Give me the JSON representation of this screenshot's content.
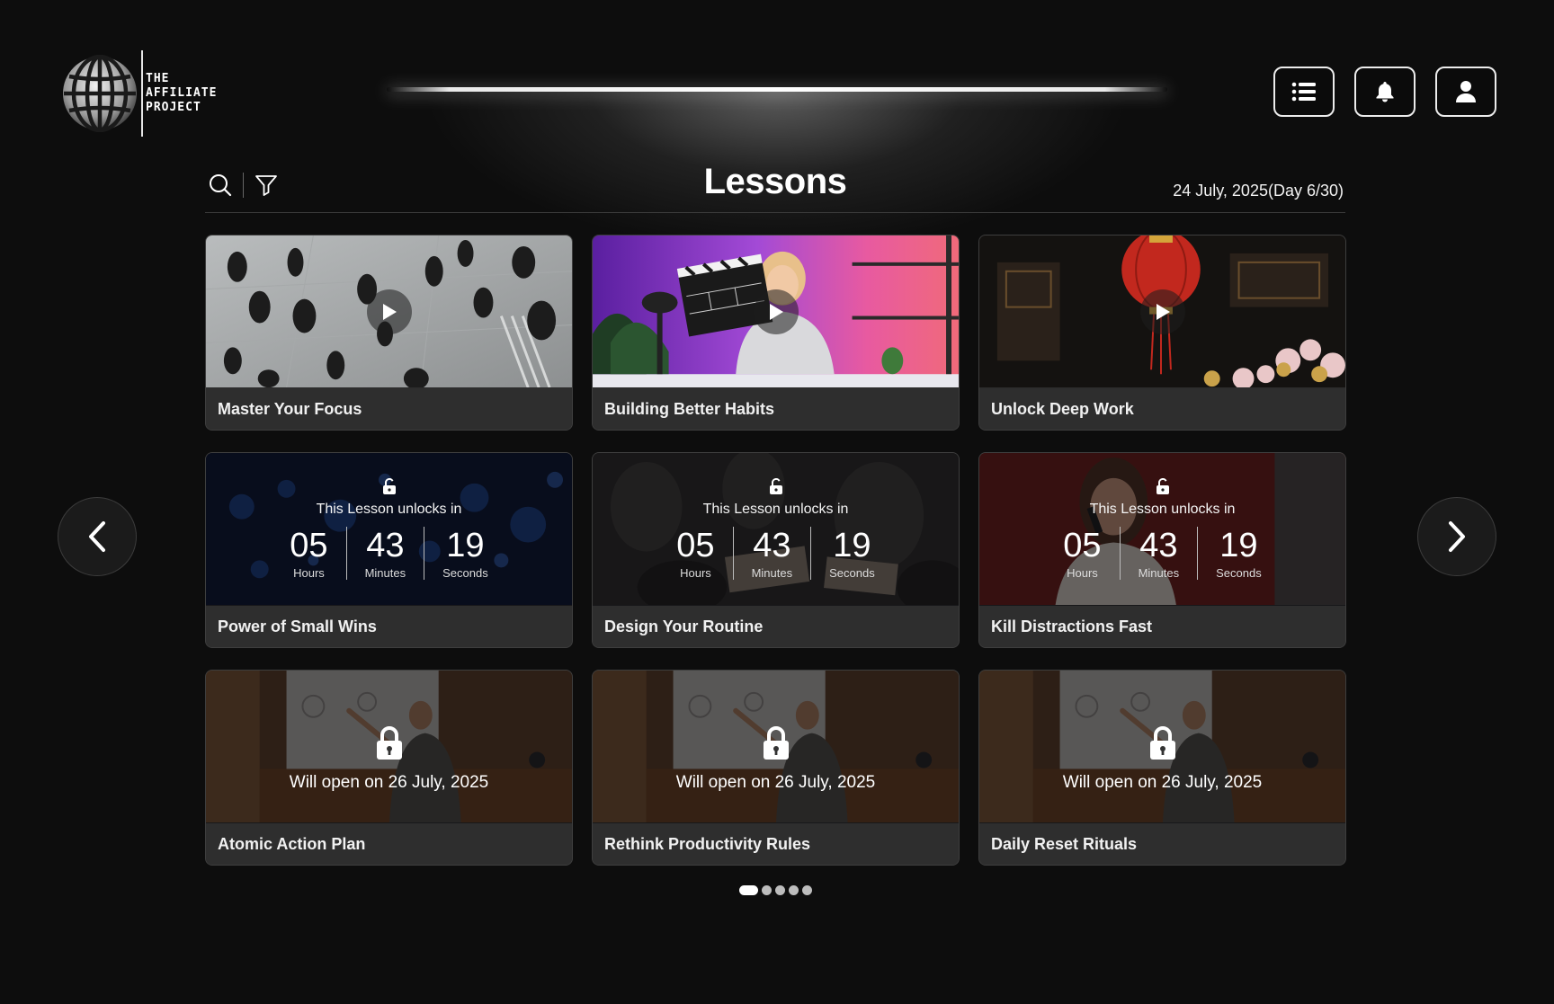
{
  "brand": {
    "name_lines": [
      "THE",
      "AFFILIATE",
      "PROJECT"
    ]
  },
  "header": {
    "buttons": [
      {
        "icon": "list-icon"
      },
      {
        "icon": "bell-icon"
      },
      {
        "icon": "user-icon"
      }
    ]
  },
  "toolbar": {
    "title": "Lessons",
    "date": "24 July, 2025(Day 6/30)",
    "icons": [
      "search-icon",
      "filter-icon"
    ]
  },
  "lessons": [
    {
      "title": "Master Your Focus",
      "status": "available"
    },
    {
      "title": "Building Better Habits",
      "status": "available"
    },
    {
      "title": "Unlock Deep Work",
      "status": "available"
    },
    {
      "title": "Power of Small Wins",
      "status": "countdown",
      "unlock_text": "This Lesson unlocks in",
      "hours": "05",
      "minutes": "43",
      "seconds": "19",
      "hours_label": "Hours",
      "minutes_label": "Minutes",
      "seconds_label": "Seconds"
    },
    {
      "title": "Design Your Routine",
      "status": "countdown",
      "unlock_text": "This Lesson unlocks in",
      "hours": "05",
      "minutes": "43",
      "seconds": "19",
      "hours_label": "Hours",
      "minutes_label": "Minutes",
      "seconds_label": "Seconds"
    },
    {
      "title": "Kill Distractions Fast",
      "status": "countdown",
      "unlock_text": "This Lesson unlocks in",
      "hours": "05",
      "minutes": "43",
      "seconds": "19",
      "hours_label": "Hours",
      "minutes_label": "Minutes",
      "seconds_label": "Seconds"
    },
    {
      "title": "Atomic Action Plan",
      "status": "locked",
      "open_text": "Will open on 26 July, 2025"
    },
    {
      "title": "Rethink Productivity Rules",
      "status": "locked",
      "open_text": "Will open on 26 July, 2025"
    },
    {
      "title": "Daily Reset Rituals",
      "status": "locked",
      "open_text": "Will open on 26 July, 2025"
    }
  ],
  "navigation": {
    "prev_icon": "chevron-left-icon",
    "next_icon": "chevron-right-icon"
  },
  "pagination": {
    "pages": 5,
    "current": 1
  },
  "colors": {
    "background": "#0d0d0d",
    "card": "#2c2c2c",
    "text": "#ffffff"
  }
}
